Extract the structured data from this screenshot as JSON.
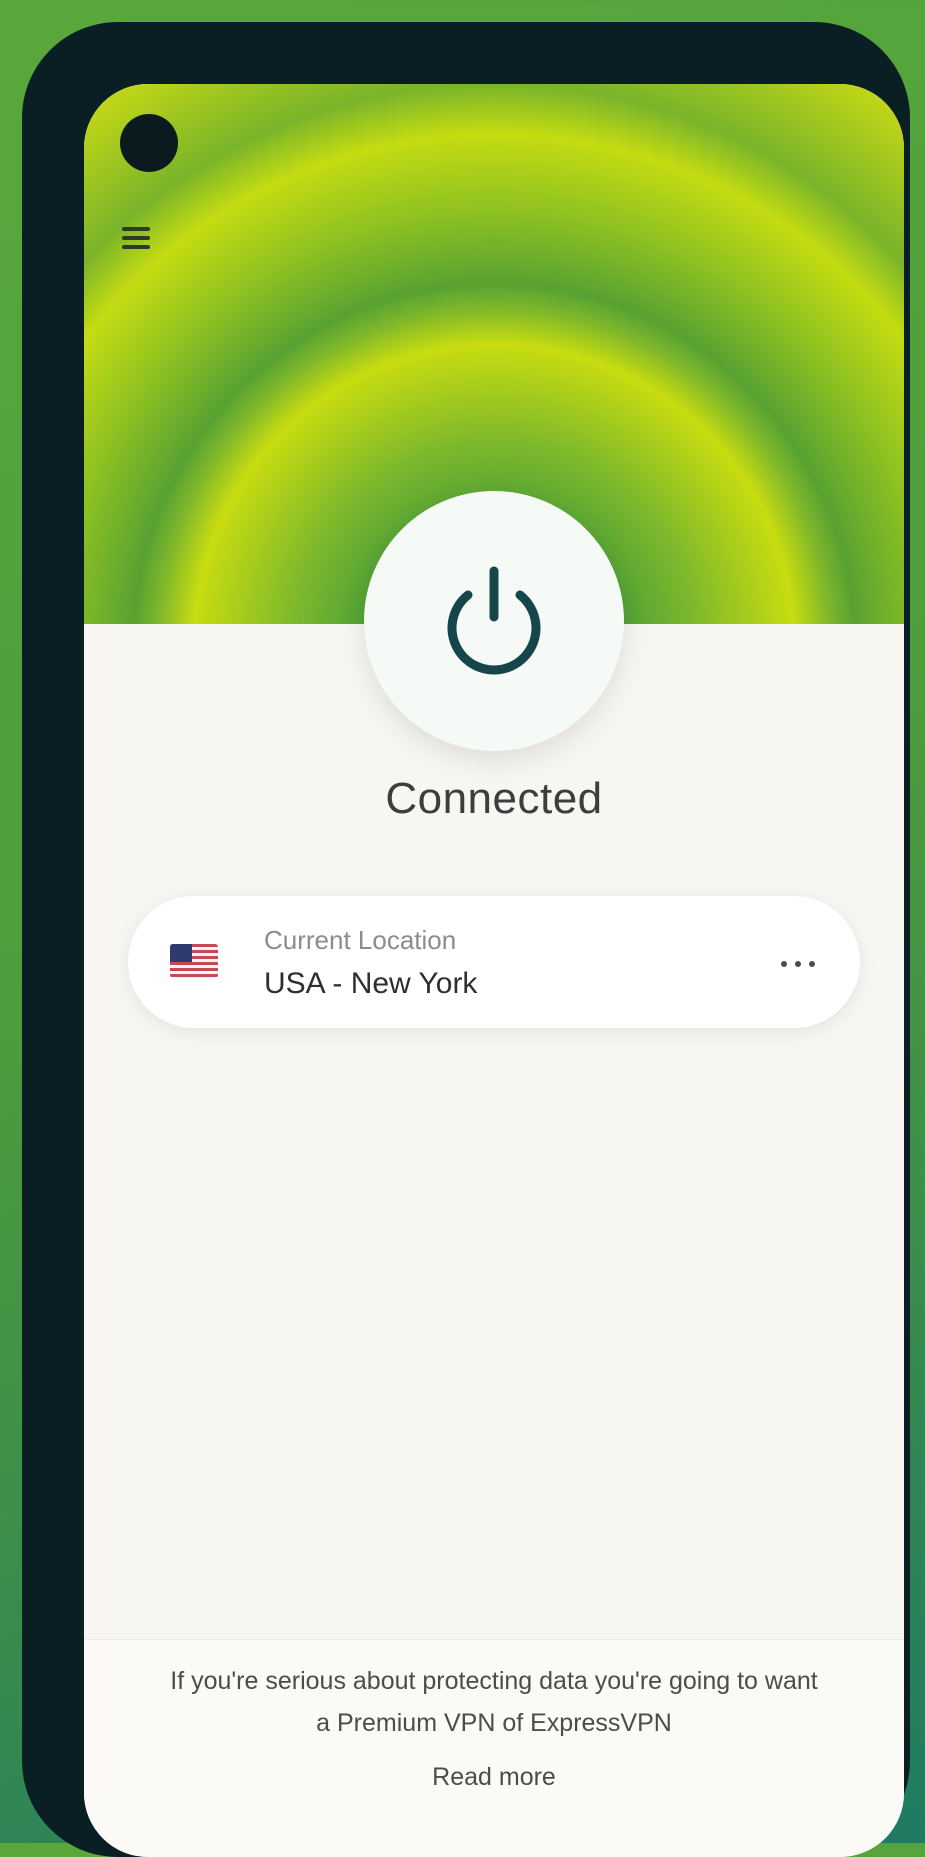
{
  "app": {
    "header": {
      "menu_icon": "hamburger-menu-icon"
    },
    "power": {
      "icon": "power-icon",
      "state": "connected"
    },
    "status": {
      "label": "Connected"
    },
    "location_card": {
      "caption": "Current Location",
      "location": "USA - New York",
      "flag_icon": "usa-flag-icon",
      "more_icon": "more-options-icon"
    },
    "footer": {
      "message": "If you're serious about protecting data you're going to want a Premium VPN of ExpressVPN",
      "link": "Read more"
    },
    "colors": {
      "accent_green": "#4c9e38",
      "accent_lime": "#c8dc10",
      "power_icon": "#17464a",
      "background": "#f8f6f2"
    }
  }
}
